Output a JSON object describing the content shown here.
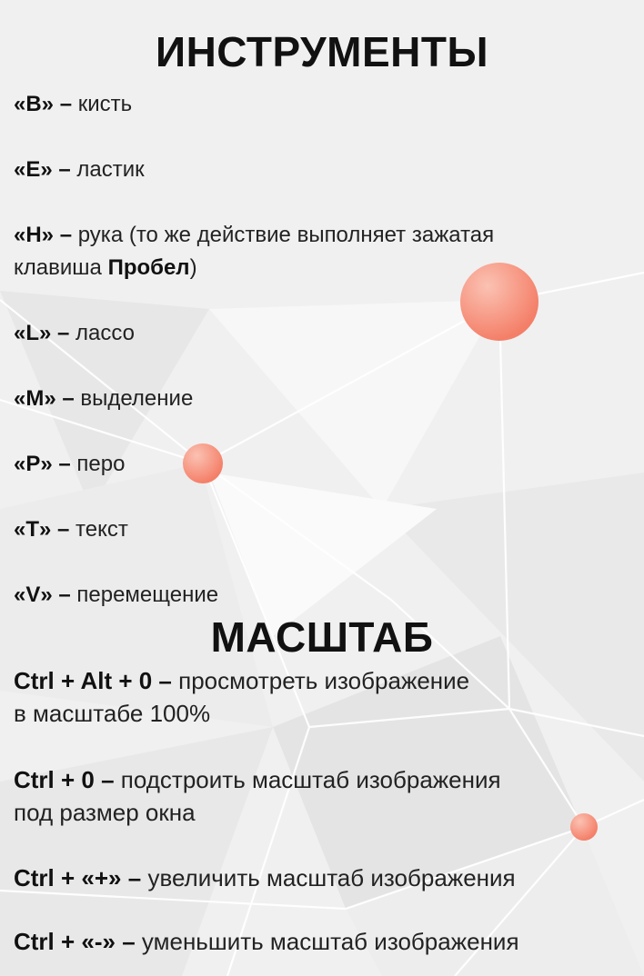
{
  "colors": {
    "accent": "#f48e78",
    "background": "#f1f1f1",
    "text": "#1a1a1a"
  },
  "tools": {
    "title": "ИНСТРУМЕНТЫ",
    "items": [
      {
        "key": "«B» –",
        "desc": "кисть"
      },
      {
        "key": "«E» –",
        "desc": "ластик"
      },
      {
        "key": "«H» –",
        "desc": "рука (то же действие выполняет зажатая клавиша",
        "bold_word": "Пробел",
        "tail": ")"
      },
      {
        "key": "«L» –",
        "desc": "лассо"
      },
      {
        "key": "«M» –",
        "desc": "выделение"
      },
      {
        "key": "«P» –",
        "desc": "перо"
      },
      {
        "key": "«T» –",
        "desc": "текст"
      },
      {
        "key": "«V» –",
        "desc": "перемещение"
      }
    ]
  },
  "zoom": {
    "title": "МАСШТАБ",
    "items": [
      {
        "key": "Ctrl + Alt + 0 –",
        "desc": "просмотреть изображение",
        "desc2": "в масштабе 100%"
      },
      {
        "key": "Ctrl + 0 –",
        "desc": "подстроить масштаб изображения",
        "desc2": "под размер окна"
      },
      {
        "key": "Ctrl + «+» –",
        "desc": "увеличить масштаб изображения"
      },
      {
        "key": "Ctrl + «-» –",
        "desc": "уменьшить масштаб изображения"
      }
    ]
  }
}
